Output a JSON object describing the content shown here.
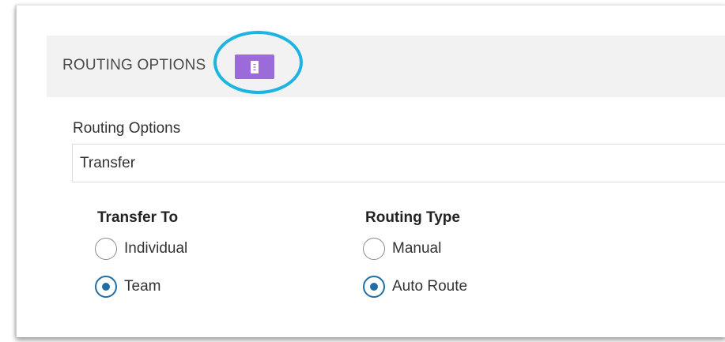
{
  "section": {
    "title": "ROUTING OPTIONS",
    "action_icon": "document-icon",
    "action_color": "#9a6bd9",
    "highlight_color": "#1cb4e0"
  },
  "routing_field": {
    "label": "Routing Options",
    "value": "Transfer"
  },
  "transfer_to": {
    "title": "Transfer To",
    "options": [
      {
        "label": "Individual",
        "selected": false
      },
      {
        "label": "Team",
        "selected": true
      }
    ]
  },
  "routing_type": {
    "title": "Routing Type",
    "options": [
      {
        "label": "Manual",
        "selected": false
      },
      {
        "label": "Auto Route",
        "selected": true
      }
    ]
  },
  "colors": {
    "radio_selected": "#1f6fa5",
    "header_bg": "#f2f2f2"
  }
}
